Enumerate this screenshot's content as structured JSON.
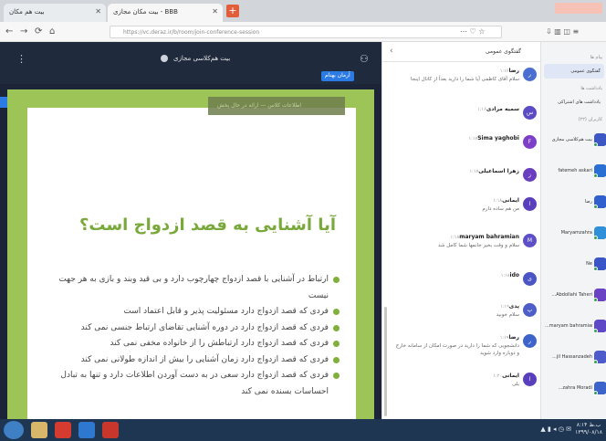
{
  "browser": {
    "tabs": [
      {
        "label": "بیت هم مکان",
        "active": false
      },
      {
        "label": "بیت مکان مجازی - BBB",
        "active": true
      }
    ],
    "new_tab_label": "+",
    "url": "https://vc.deraz.ir/b/room/join-conference-session",
    "nav": {
      "back": "←",
      "forward": "→",
      "reload": "⟳",
      "home": "⌂"
    },
    "right_icons": "⋯ ♡ ☆",
    "toolbar_icons": "⇩ ▥ ◫ ≡"
  },
  "main": {
    "menu_icon": "⋮",
    "room_title": "بیت هم‌کلاسی مجازی",
    "users_icon": "⚇",
    "presenter_badge": "آرمان بهنام",
    "slide": {
      "banner_text": "اطلاعات کلاس — ارائه در حال پخش",
      "title": "آیا آشنایی به قصد ازدواج است؟",
      "bullets": [
        "ارتباط در آشنایی با قصد ازدواج چهارچوب دارد و بی قید وبند و بازی به هر جهت نیست",
        "فردی که قصد ازدواج دارد مسئولیت پذیر و قابل اعتماد است",
        "فردی که قصد ازدواج دارد در دوره آشنایی تقاضای ارتباط جنسی نمی کند",
        "فردی که قصد ازدواج دارد ارتباطش را از خانواده مخفی نمی کند",
        "فردی که قصد ازدواج دارد زمان آشنایی را بیش از اندازه طولانی نمی کند",
        "فردی که قصد ازدواج دارد سعی در به دست آوردن اطلاعات دارد و تنها به تبادل احساسات بسنده نمی کند"
      ]
    }
  },
  "chat": {
    "header_title": "گفتگوی عمومی",
    "header_icon": "‹",
    "messages": [
      {
        "initial": "ر",
        "name": "رضا",
        "time": "۱:۱۶",
        "text": "سلام آقای کاظمی آیا شما را دارید بعداً از کانال اینجا",
        "color": "#4a6fd0"
      },
      {
        "initial": "س",
        "name": "سمیه مرادی",
        "time": "۱:۱۶",
        "text": "",
        "color": "#5b4bc4"
      },
      {
        "initial": "F",
        "name": "Sima yaghobi",
        "time": "۱:۱۷",
        "text": "",
        "color": "#7d3fc7"
      },
      {
        "initial": "ز",
        "name": "زهرا اسماعیلی",
        "time": "۱:۱۷",
        "text": "",
        "color": "#6a3fbf"
      },
      {
        "initial": "ا",
        "name": "ایمانی",
        "time": "۱:۱۸",
        "text": "من هم ساده دارم",
        "color": "#5a3fbd"
      },
      {
        "initial": "M",
        "name": "maryam bahramian",
        "time": "۱:۱۸",
        "text": "سلام و وقت بخیر خانمها شما کامل شد",
        "color": "#5c4fc8"
      },
      {
        "initial": "ی",
        "name": "ido",
        "time": "۱:۱۸",
        "text": "",
        "color": "#4b56c4"
      },
      {
        "initial": "پ",
        "name": "پدی",
        "time": "۱:۱۹",
        "text": "سلام خوبید",
        "color": "#4d5ec9"
      },
      {
        "initial": "ر",
        "name": "رضا",
        "time": "۱:۱۹",
        "text": "دانشجویی که شما را دارید در صورت امکان از سامانه خارج و دوباره وارد شوید",
        "color": "#3e63c9"
      },
      {
        "initial": "ا",
        "name": "ایمانی",
        "time": "۱:۲۰",
        "text": "بلی",
        "color": "#5a3fbd"
      }
    ]
  },
  "users": {
    "section_public": "پیام ها",
    "public_chat_item": "گفتگوی عمومی",
    "section_notes": "یادداشت ها",
    "shared_notes_item": "یادداشت های اشتراکی",
    "section_users": "کاربران (۲۲)",
    "list": [
      {
        "name": "بیت هم‌کلاسی مجازی",
        "color": "#3c56c4"
      },
      {
        "name": "fatemeh askari",
        "color": "#2a6fd2"
      },
      {
        "name": "رضا",
        "color": "#315fcd"
      },
      {
        "name": "Maryamzahra",
        "color": "#2f8fd8"
      },
      {
        "name": "Ne",
        "color": "#3a55c8"
      },
      {
        "name": "...Abdollahi Taheri",
        "color": "#6a42c4"
      },
      {
        "name": "...maryam bahramian",
        "color": "#5e48c6"
      },
      {
        "name": "...jil Hassanzadeh",
        "color": "#4e5ccb"
      },
      {
        "name": "...zahra Moradi",
        "color": "#3b63c9"
      }
    ]
  },
  "taskbar": {
    "tray": "▲ ▮ ◂ ◷ ✉",
    "clock_time": "۸:۱۴ ب.ظ",
    "clock_date": "۱۳۹۹/۰۸/۱۸"
  }
}
